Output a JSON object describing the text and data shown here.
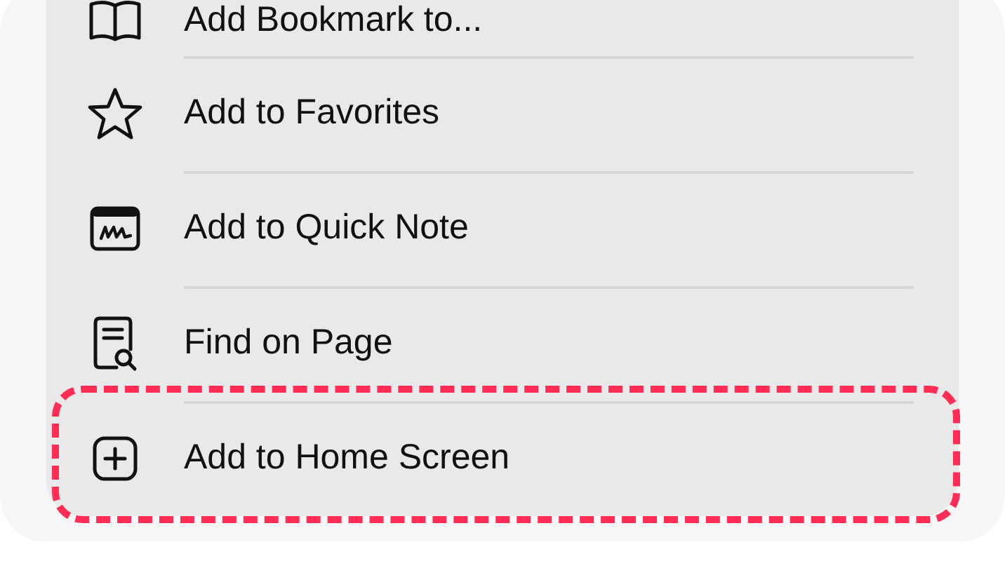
{
  "menu": {
    "items": [
      {
        "label": "Add Bookmark to...",
        "highlighted": false
      },
      {
        "label": "Add to Favorites",
        "highlighted": false
      },
      {
        "label": "Add to Quick Note",
        "highlighted": false
      },
      {
        "label": "Find on Page",
        "highlighted": false
      },
      {
        "label": "Add to Home Screen",
        "highlighted": true
      }
    ]
  }
}
